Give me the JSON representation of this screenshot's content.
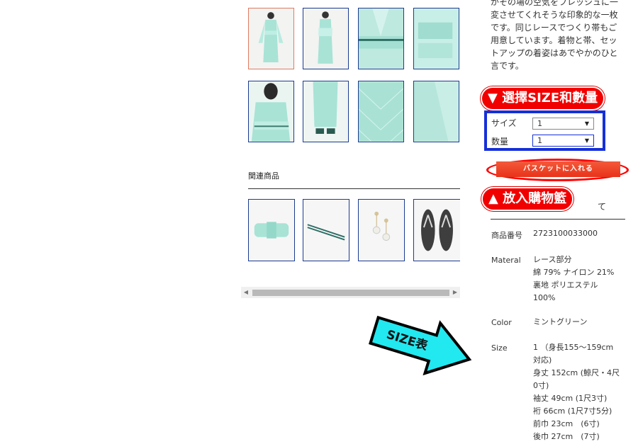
{
  "description": {
    "lines": [
      "がその場の空気をフレッシュに一",
      "変させてくれそうな印象的な一枚",
      "です。同じレースでつくり帯もご",
      "用意しています。着物と帯、セッ",
      "トアップの着姿はあでやかのひと",
      "言です。"
    ]
  },
  "annotations": {
    "select_size_qty": "▼ 選擇SIZE和數量",
    "add_to_cart": "▲ 放入購物籃",
    "size_table": "SIZE表"
  },
  "options": {
    "size_label": "サイズ",
    "size_value": "1",
    "qty_label": "数量",
    "qty_value": "1"
  },
  "basket_button": "バスケットに入れる",
  "related": {
    "title": "関連商品"
  },
  "specs": {
    "product_no_label": "商品番号",
    "product_no": "2723100033000",
    "material_label": "Materal",
    "material_lines": [
      "レース部分",
      "綿 79% ナイロン 21%",
      "裏地 ポリエステル",
      "100%"
    ],
    "color_label": "Color",
    "color": "ミントグリーン",
    "size_label": "Size",
    "size_lines": [
      "1 （身長155～159cm",
      "対応)",
      "身丈 152cm (鯨尺・4尺",
      "0寸)",
      "袖丈 49cm (1尺3寸)",
      "裄 66cm (1尺7寸5分)",
      "前巾 23cm　(6寸)",
      "後巾 27cm　(7寸)"
    ]
  },
  "colors": {
    "accent_red": "#f10000",
    "box_blue": "#1530d8",
    "arrow_cyan": "#22e8f0",
    "kimono_mint": "#a8e3d6"
  }
}
